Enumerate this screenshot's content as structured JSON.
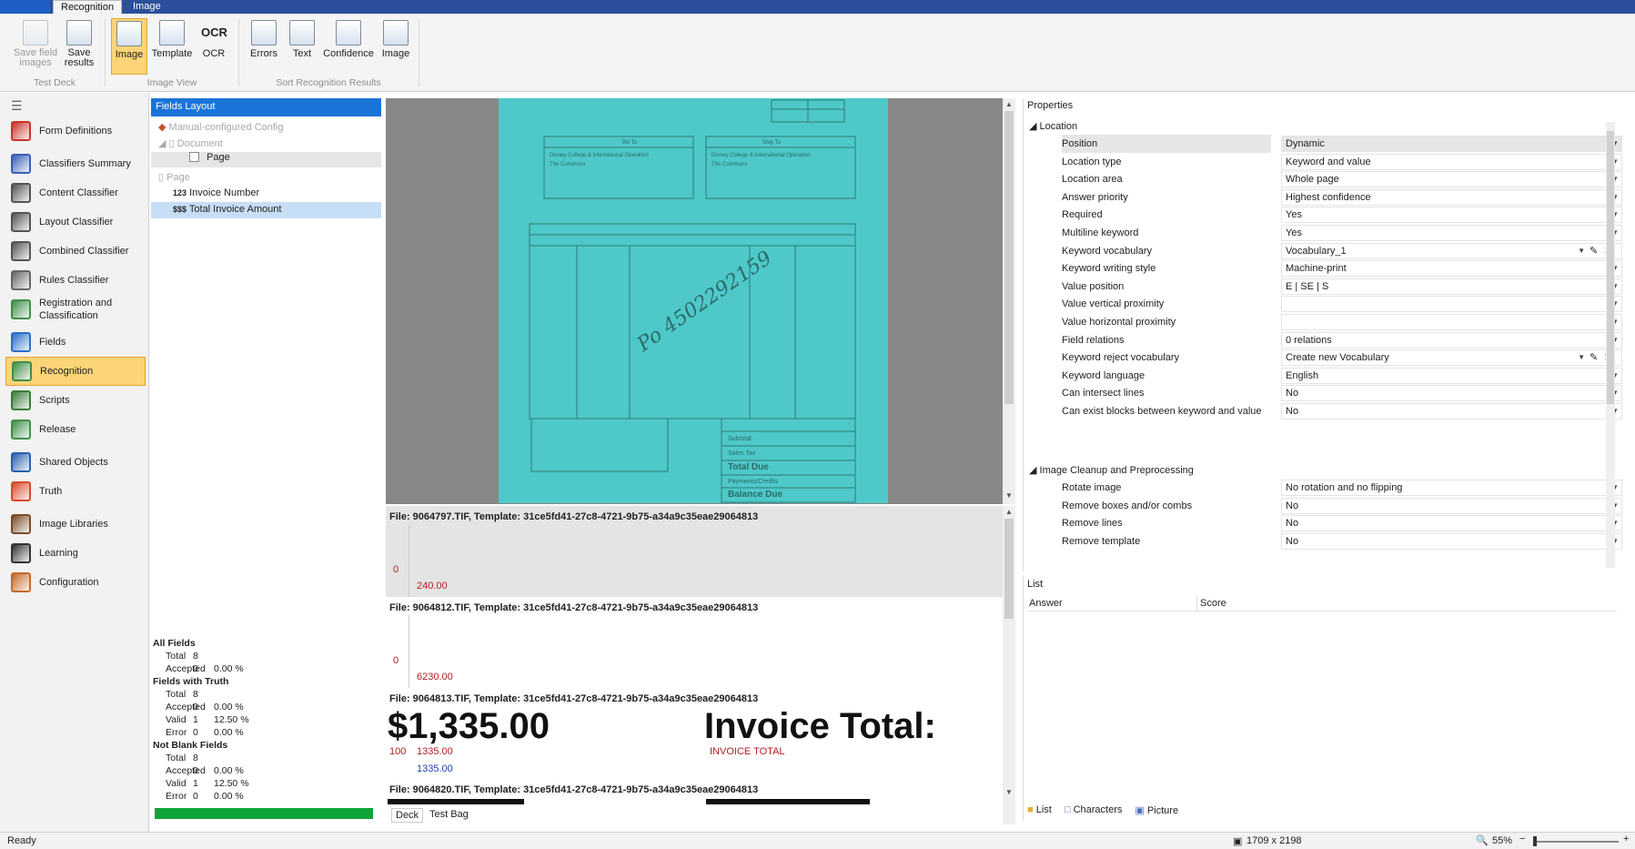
{
  "titlebar": {
    "tabs": [
      "Recognition",
      "Image"
    ]
  },
  "ribbon": {
    "buttons": [
      {
        "label": "Save field\nimages",
        "icon": "save-images-icon"
      },
      {
        "label": "Save\nresults",
        "icon": "save-results-icon"
      },
      {
        "label": "Image",
        "icon": "image-view-icon"
      },
      {
        "label": "Template",
        "icon": "template-icon"
      },
      {
        "label": "OCR",
        "icon": "ocr-icon"
      },
      {
        "label": "Errors",
        "icon": "errors-icon"
      },
      {
        "label": "Text",
        "icon": "text-sort-icon"
      },
      {
        "label": "Confidence",
        "icon": "confidence-icon"
      },
      {
        "label": "Image",
        "icon": "image-sort-icon"
      }
    ],
    "groups": [
      "Test Deck",
      "Image View",
      "Sort Recognition Results"
    ]
  },
  "nav": {
    "items": [
      {
        "label": "Form Definitions",
        "icon": "form-definitions-icon",
        "color": "#c9352e"
      },
      {
        "label": "Classifiers Summary",
        "icon": "classifiers-summary-icon",
        "color": "#3b5eb8"
      },
      {
        "label": "Content Classifier",
        "icon": "content-classifier-icon",
        "color": "#555555"
      },
      {
        "label": "Layout Classifier",
        "icon": "layout-classifier-icon",
        "color": "#555555"
      },
      {
        "label": "Combined Classifier",
        "icon": "combined-classifier-icon",
        "color": "#555555"
      },
      {
        "label": "Rules Classifier",
        "icon": "rules-classifier-icon",
        "color": "#666666"
      },
      {
        "label": "Registration and\nClassification",
        "icon": "registration-icon",
        "color": "#3f8f48"
      },
      {
        "label": "Fields",
        "icon": "fields-icon",
        "color": "#2b6fc6"
      },
      {
        "label": "Recognition",
        "icon": "recognition-icon",
        "color": "#3f8f48"
      },
      {
        "label": "Scripts",
        "icon": "scripts-icon",
        "color": "#3a7d3a"
      },
      {
        "label": "Release",
        "icon": "release-icon",
        "color": "#3f8f48"
      },
      {
        "label": "Shared Objects",
        "icon": "shared-objects-icon",
        "color": "#2b5fb0"
      },
      {
        "label": "Truth",
        "icon": "truth-icon",
        "color": "#d94a2b"
      },
      {
        "label": "Image Libraries",
        "icon": "image-libraries-icon",
        "color": "#7a4d2a"
      },
      {
        "label": "Learning",
        "icon": "learning-icon",
        "color": "#333333"
      },
      {
        "label": "Configuration",
        "icon": "configuration-icon",
        "color": "#c46a2b"
      }
    ]
  },
  "fields_layout": {
    "title": "Fields Layout",
    "tree": {
      "config": "Manual-configured Config",
      "document": "Document",
      "page_checked": "Page",
      "page": "Page",
      "invoice_number": "Invoice Number",
      "invoice_number_prefix": "123",
      "total_invoice": "Total Invoice Amount",
      "total_invoice_prefix": "$$$"
    },
    "stats": {
      "all_fields": "All Fields",
      "fields_with_truth": "Fields with Truth",
      "not_blank": "Not Blank Fields",
      "rows": [
        [
          "Total",
          "8",
          ""
        ],
        [
          "Accepted",
          "0",
          "0.00 %"
        ],
        [
          "Total",
          "8",
          ""
        ],
        [
          "Accepted",
          "0",
          "0.00 %"
        ],
        [
          "Valid",
          "1",
          "12.50 %"
        ],
        [
          "Error",
          "0",
          "0.00 %"
        ],
        [
          "Total",
          "8",
          ""
        ],
        [
          "Accepted",
          "0",
          "0.00 %"
        ],
        [
          "Valid",
          "1",
          "12.50 %"
        ],
        [
          "Error",
          "0",
          "0.00 %"
        ]
      ]
    }
  },
  "results": {
    "items": [
      {
        "header": "File: 9064797.TIF, Template: 31ce5fd41-27c8-4721-9b75-a34a9c35eae29064813",
        "conf": "0",
        "value": "240.00"
      },
      {
        "header": "File: 9064812.TIF, Template: 31ce5fd41-27c8-4721-9b75-a34a9c35eae29064813",
        "conf": "0",
        "value": "6230.00"
      },
      {
        "header": "File: 9064813.TIF, Template: 31ce5fd41-27c8-4721-9b75-a34a9c35eae29064813",
        "big_amount": "$1,335.00",
        "big_label": "Invoice Total:",
        "conf": "100",
        "value": "1335.00",
        "truth": "1335.00",
        "kw": "INVOICE TOTAL"
      },
      {
        "header": "File: 9064820.TIF, Template: 31ce5fd41-27c8-4721-9b75-a34a9c35eae29064813"
      }
    ],
    "tabs": [
      "Deck",
      "Test Bag"
    ]
  },
  "properties": {
    "title": "Properties",
    "section_location": "Location",
    "section_cleanup": "Image Cleanup and Preprocessing",
    "rows": [
      {
        "label": "Position",
        "value": "Dynamic"
      },
      {
        "label": "Location type",
        "value": "Keyword and value"
      },
      {
        "label": "Location area",
        "value": "Whole page"
      },
      {
        "label": "Answer priority",
        "value": "Highest confidence"
      },
      {
        "label": "Required",
        "value": "Yes"
      },
      {
        "label": "Multiline keyword",
        "value": "Yes"
      },
      {
        "label": "Keyword vocabulary",
        "value": "Vocabulary_1"
      },
      {
        "label": "Keyword writing style",
        "value": "Machine-print"
      },
      {
        "label": "Value position",
        "value": "E | SE | S"
      },
      {
        "label": "Value vertical proximity",
        "value": ""
      },
      {
        "label": "Value horizontal proximity",
        "value": ""
      },
      {
        "label": "Field relations",
        "value": "0 relations"
      },
      {
        "label": "Keyword reject vocabulary",
        "value": "Create new Vocabulary"
      },
      {
        "label": "Keyword language",
        "value": "English"
      },
      {
        "label": "Can intersect lines",
        "value": "No"
      },
      {
        "label": "Can exist blocks between keyword and value",
        "value": "No"
      }
    ],
    "cleanup_rows": [
      {
        "label": "Rotate image",
        "value": "No rotation and no flipping"
      },
      {
        "label": "Remove boxes and/or combs",
        "value": "No"
      },
      {
        "label": "Remove lines",
        "value": "No"
      },
      {
        "label": "Remove template",
        "value": "No"
      }
    ]
  },
  "list": {
    "title": "List",
    "col_answer": "Answer",
    "col_score": "Score",
    "tabs": [
      "List",
      "Characters",
      "Picture"
    ]
  },
  "status": {
    "ready": "Ready",
    "dims": "1709 x 2198",
    "zoom": "55%"
  }
}
